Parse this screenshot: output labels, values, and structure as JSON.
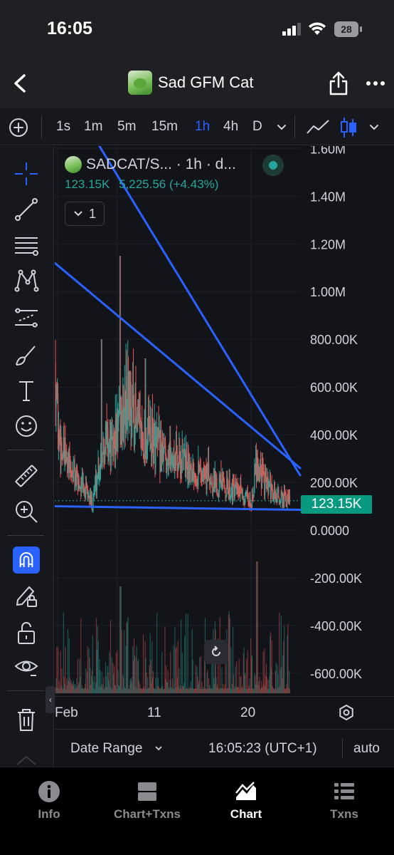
{
  "status_bar": {
    "time": "16:05",
    "battery": "28",
    "icons": [
      "signal-icon",
      "wifi-icon",
      "battery-icon"
    ]
  },
  "nav": {
    "title": "Sad GFM Cat",
    "icons": [
      "back-icon",
      "share-icon",
      "more-icon"
    ]
  },
  "toolbar": {
    "intervals": [
      {
        "label": "1s",
        "active": false
      },
      {
        "label": "1m",
        "active": false
      },
      {
        "label": "5m",
        "active": false
      },
      {
        "label": "15m",
        "active": false
      },
      {
        "label": "1h",
        "active": true
      },
      {
        "label": "4h",
        "active": false
      },
      {
        "label": "D",
        "active": false
      }
    ],
    "accent": "#2962ff"
  },
  "legend": {
    "symbol": "SADCAT/S... · 1h · d...",
    "price": "123.15K",
    "change": "5,225.56 (+4.43%)",
    "indicators_count": "1"
  },
  "chart_data": {
    "type": "candlestick",
    "y_axis_labels": [
      "1.60M",
      "1.40M",
      "1.20M",
      "1.00M",
      "800.00K",
      "600.00K",
      "400.00K",
      "200.00K",
      "0.0000",
      "-200.00K",
      "-400.00K",
      "-600.00K"
    ],
    "ylim": [
      -690000,
      1610000
    ],
    "x_axis_labels": [
      "Feb",
      "11",
      "20"
    ],
    "x_days": [
      7,
      11,
      20
    ],
    "xlim": [
      6.8,
      23.3
    ],
    "last_price": 123150,
    "last_price_label": "123.15K",
    "trend_lines": [
      {
        "from": [
          6.8,
          1120000
        ],
        "to": [
          23.3,
          260000
        ]
      },
      {
        "from": [
          9.8,
          1610000
        ],
        "to": [
          23.3,
          230000
        ]
      },
      {
        "from": [
          6.8,
          100000
        ],
        "to": [
          23.3,
          85000
        ]
      }
    ],
    "up_color": "#26a69a",
    "down_color": "#ef5350",
    "line_color": "#2962ff"
  },
  "time_axis": {
    "labels": [
      "Feb",
      "11",
      "20"
    ]
  },
  "bottom_controls": {
    "date_range": "Date Range",
    "clock": "16:05:23 (UTC+1)",
    "scale": "auto"
  },
  "tabs": [
    {
      "label": "Info",
      "icon": "info-icon",
      "active": false
    },
    {
      "label": "Chart+Txns",
      "icon": "split-view-icon",
      "active": false
    },
    {
      "label": "Chart",
      "icon": "chart-icon",
      "active": true
    },
    {
      "label": "Txns",
      "icon": "list-icon",
      "active": false
    }
  ]
}
